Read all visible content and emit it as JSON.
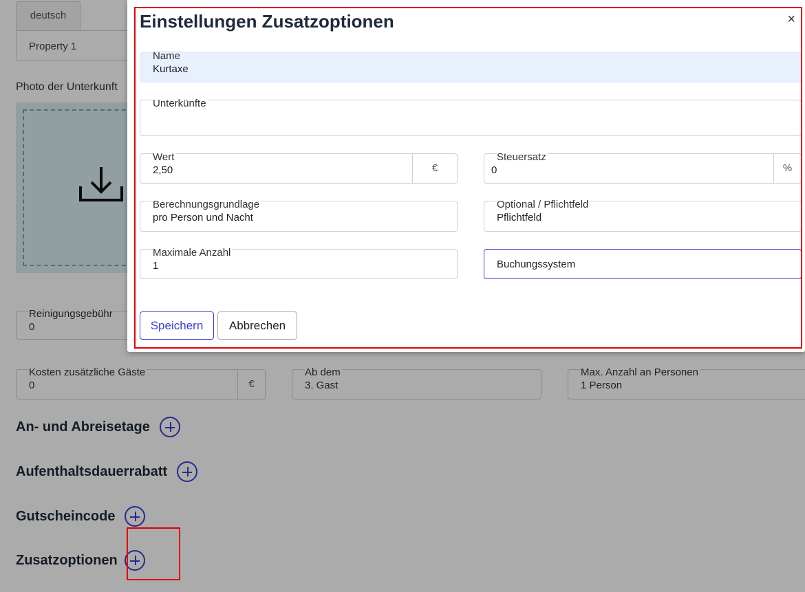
{
  "background": {
    "language_tab": "deutsch",
    "property_select": "Property 1",
    "photo_label": "Photo der Unterkunft",
    "cleaning_fee": {
      "label": "Reinigungsgebühr",
      "value": "0"
    },
    "extra_guest_cost": {
      "label": "Kosten zusätzliche Gäste",
      "value": "0",
      "unit": "€"
    },
    "from_guest": {
      "label": "Ab dem",
      "value": "3. Gast"
    },
    "max_persons": {
      "label": "Max. Anzahl an Personen",
      "value": "1 Person"
    },
    "sections": [
      {
        "label": "An- und Abreisetage"
      },
      {
        "label": "Aufenthaltsdauerrabatt"
      },
      {
        "label": "Gutscheincode"
      },
      {
        "label": "Zusatzoptionen"
      }
    ]
  },
  "modal": {
    "title": "Einstellungen Zusatzoptionen",
    "close_symbol": "×",
    "name": {
      "label": "Name",
      "value": "Kurtaxe"
    },
    "accommodations": {
      "label": "Unterkünfte",
      "value": ""
    },
    "value": {
      "label": "Wert",
      "value": "2,50",
      "unit": "€"
    },
    "tax_rate": {
      "label": "Steuersatz",
      "value": "0",
      "unit": "%"
    },
    "calculation_basis": {
      "label": "Berechnungsgrundlage",
      "value": "pro Person und Nacht"
    },
    "optional_required": {
      "label": "Optional / Pflichtfeld",
      "value": "Pflichtfeld"
    },
    "max_count": {
      "label": "Maximale Anzahl",
      "value": "1"
    },
    "booking_system": {
      "placeholder": "Buchungssystem"
    },
    "save_label": "Speichern",
    "cancel_label": "Abbrechen"
  },
  "colors": {
    "accent": "#3a3fd1",
    "highlight_frame": "#e00000",
    "autofill_bg": "#e8f0fe"
  }
}
